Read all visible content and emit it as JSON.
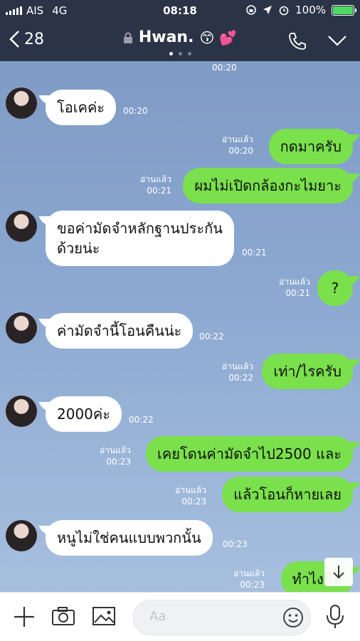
{
  "status": {
    "carrier": "AIS",
    "network": "4G",
    "time": "08:18",
    "battery": "100%"
  },
  "header": {
    "back_count": "28",
    "title": "Hwan.",
    "emoji": "😙 💕"
  },
  "top_time": "00:20",
  "messages": [
    {
      "dir": "in",
      "text": "โอเคค่ะ",
      "time": "00:20"
    },
    {
      "dir": "out",
      "read": "อ่านแล้ว",
      "text": "กดมาครับ",
      "time": "00:20"
    },
    {
      "dir": "out",
      "read": "อ่านแล้ว",
      "text": "ผมไม่เปิดกล้องกะไมยาะ",
      "time": "00:21"
    },
    {
      "dir": "in",
      "text": "ขอค่ามัดจำหลักฐานประกัน",
      "text2": "ด้วยน่ะ",
      "time": "00:21"
    },
    {
      "dir": "out",
      "read": "อ่านแล้ว",
      "text": "?",
      "time": "00:21"
    },
    {
      "dir": "in",
      "text": "ค่ามัดจำนี้โอนคืนน่ะ",
      "time": "00:22"
    },
    {
      "dir": "out",
      "read": "อ่านแล้ว",
      "text": "เท่า/ไรครับ",
      "time": "00:22"
    },
    {
      "dir": "in",
      "text": "2000ค่ะ",
      "time": "00:22"
    },
    {
      "dir": "out",
      "read": "อ่านแล้ว",
      "text": "เคยโดนค่ามัดจำไป2500 และ",
      "time": "00:23"
    },
    {
      "dir": "out",
      "read": "อ่านแล้ว",
      "text": "แล้วโอนก็หายเลย",
      "time": "00:23"
    },
    {
      "dir": "in",
      "text": "หนูไม่ใช่คนแบบพวกนั้น",
      "time": "00:23"
    },
    {
      "dir": "out",
      "read": "อ่านแล้ว",
      "text": "ทำไงดีล",
      "time": "00:23"
    }
  ],
  "input": {
    "placeholder": "Aa"
  },
  "colors": {
    "header": "#2b3446",
    "out_bubble": "#7ae04c",
    "in_bubble": "#ffffff",
    "chat_bg": "#7e9bc6"
  }
}
